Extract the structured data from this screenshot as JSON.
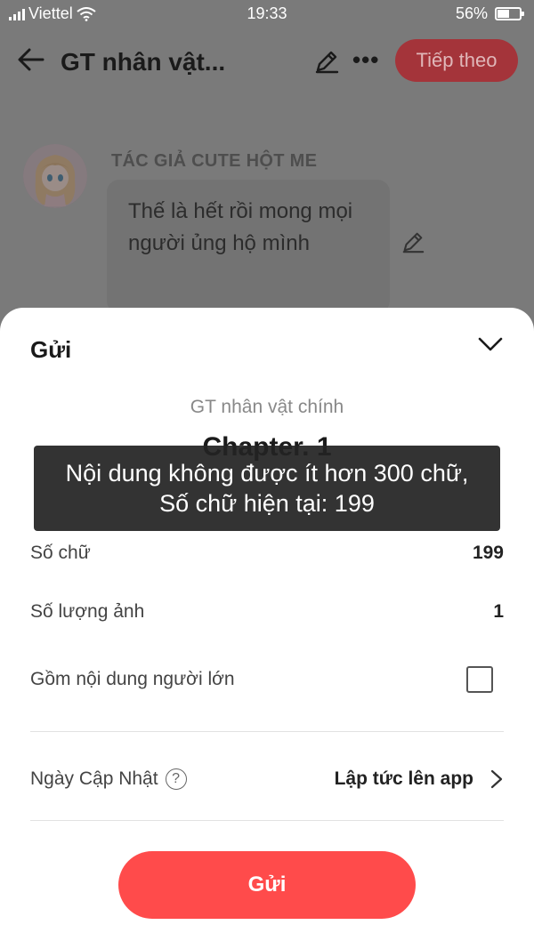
{
  "status_bar": {
    "carrier": "Viettel",
    "time": "19:33",
    "battery": "56%",
    "battery_level": 0.56,
    "icons": [
      "signal-icon",
      "wifi-icon",
      "battery-icon"
    ]
  },
  "header": {
    "title": "GT nhân vật...",
    "next_label": "Tiếp theo",
    "more_label": "•••"
  },
  "post": {
    "author": "TÁC GIẢ CUTE HỘT ME",
    "message": "Thế là hết rồi mong mọi người ủng hộ mình"
  },
  "sheet": {
    "title": "Gửi",
    "story_name": "GT nhân vật chính",
    "chapter_name": "Chapter. 1",
    "rows": {
      "word_count_label": "Số chữ",
      "word_count_value": "199",
      "image_count_label": "Số lượng ảnh",
      "image_count_value": "1",
      "adult_label": "Gồm nội dung người lớn",
      "adult_checked": false,
      "update_date_label": "Ngày Cập Nhật",
      "update_date_help": "?",
      "update_date_value": "Lập tức lên app"
    },
    "submit_label": "Gửi"
  },
  "toast": {
    "line1": "Nội dung không được ít hơn 300 chữ,",
    "line2": "Số chữ hiện tại: 199"
  },
  "colors": {
    "accent": "#ff4b4b",
    "overlay_accent": "#a4343a",
    "toast_bg": "#232323"
  }
}
